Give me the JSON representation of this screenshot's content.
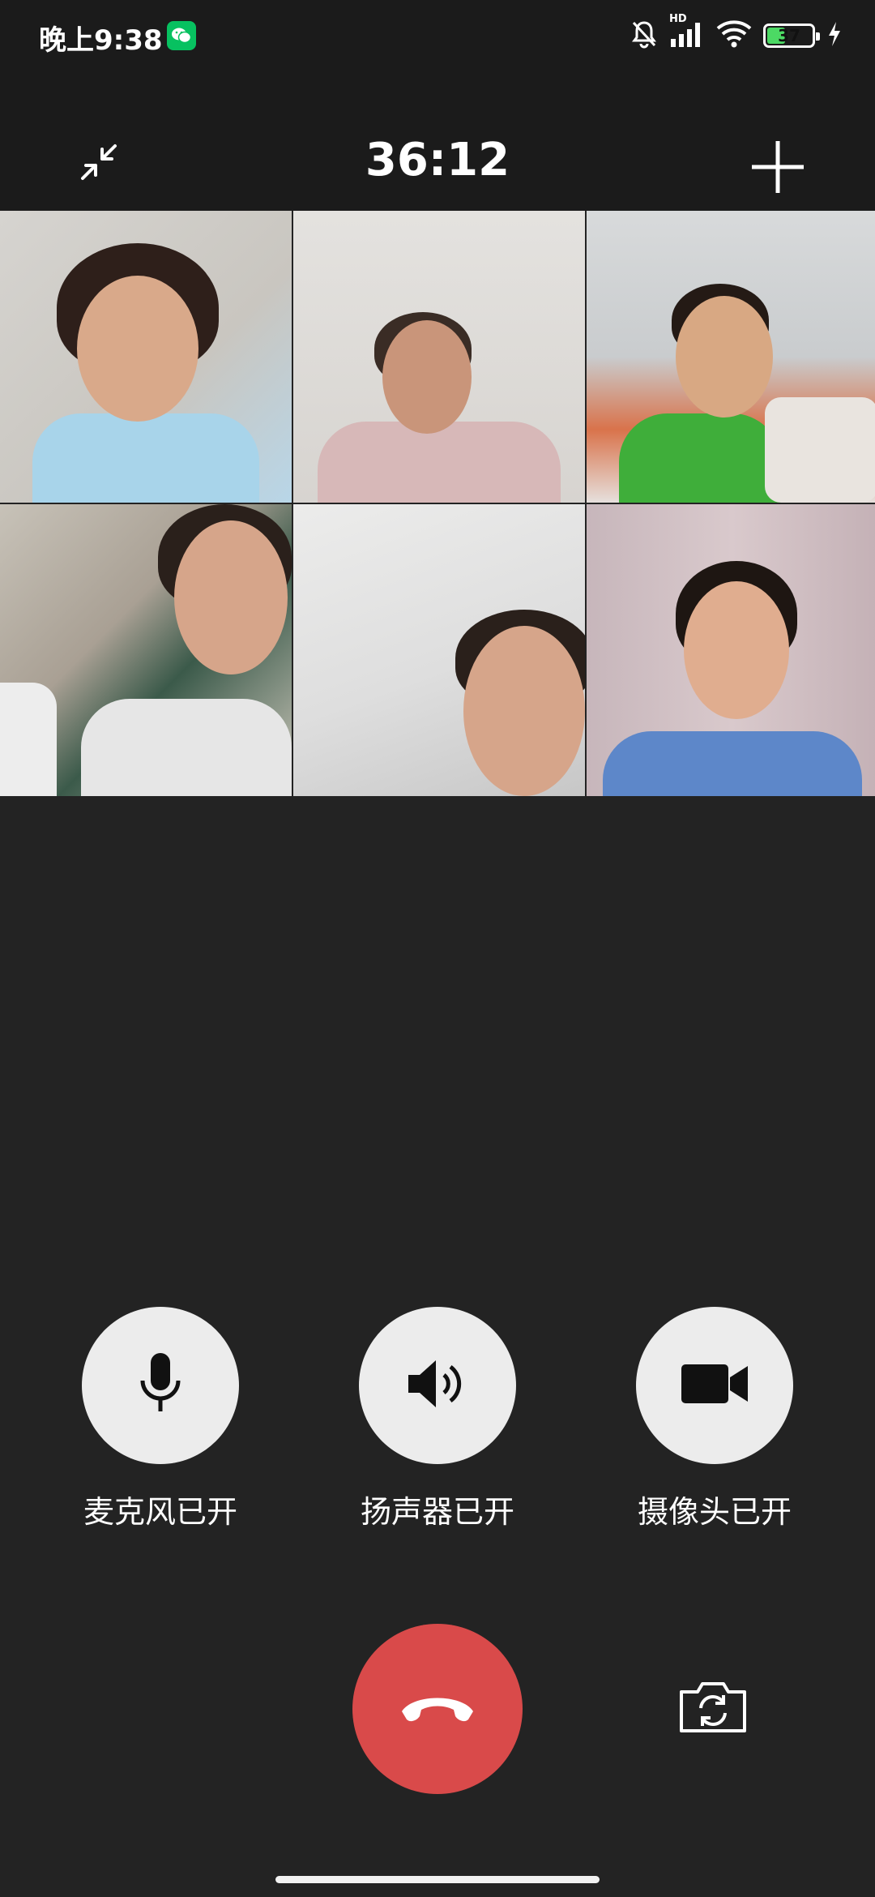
{
  "status_bar": {
    "time": "晚上9:38",
    "battery_level": "37",
    "network": "HD",
    "icons": [
      "wechat-icon",
      "mute-bell-icon",
      "signal-icon",
      "wifi-icon",
      "battery-icon",
      "charging-icon"
    ]
  },
  "header": {
    "timer": "36:12",
    "minimize_icon": "minimize-icon",
    "add_icon": "add-participant-icon"
  },
  "participants": [
    {
      "position": "top-left"
    },
    {
      "position": "top-middle"
    },
    {
      "position": "top-right"
    },
    {
      "position": "bottom-left"
    },
    {
      "position": "bottom-middle"
    },
    {
      "position": "bottom-right"
    }
  ],
  "controls": {
    "microphone_label": "麦克风已开",
    "speaker_label": "扬声器已开",
    "camera_label": "摄像头已开"
  },
  "actions": {
    "hangup_icon": "hangup-icon",
    "flip_camera_icon": "flip-camera-icon"
  },
  "colors": {
    "background": "#232323",
    "hangup": "#d94a4a",
    "control_button": "#ececec",
    "battery": "#4cd964",
    "wechat": "#07c160"
  }
}
